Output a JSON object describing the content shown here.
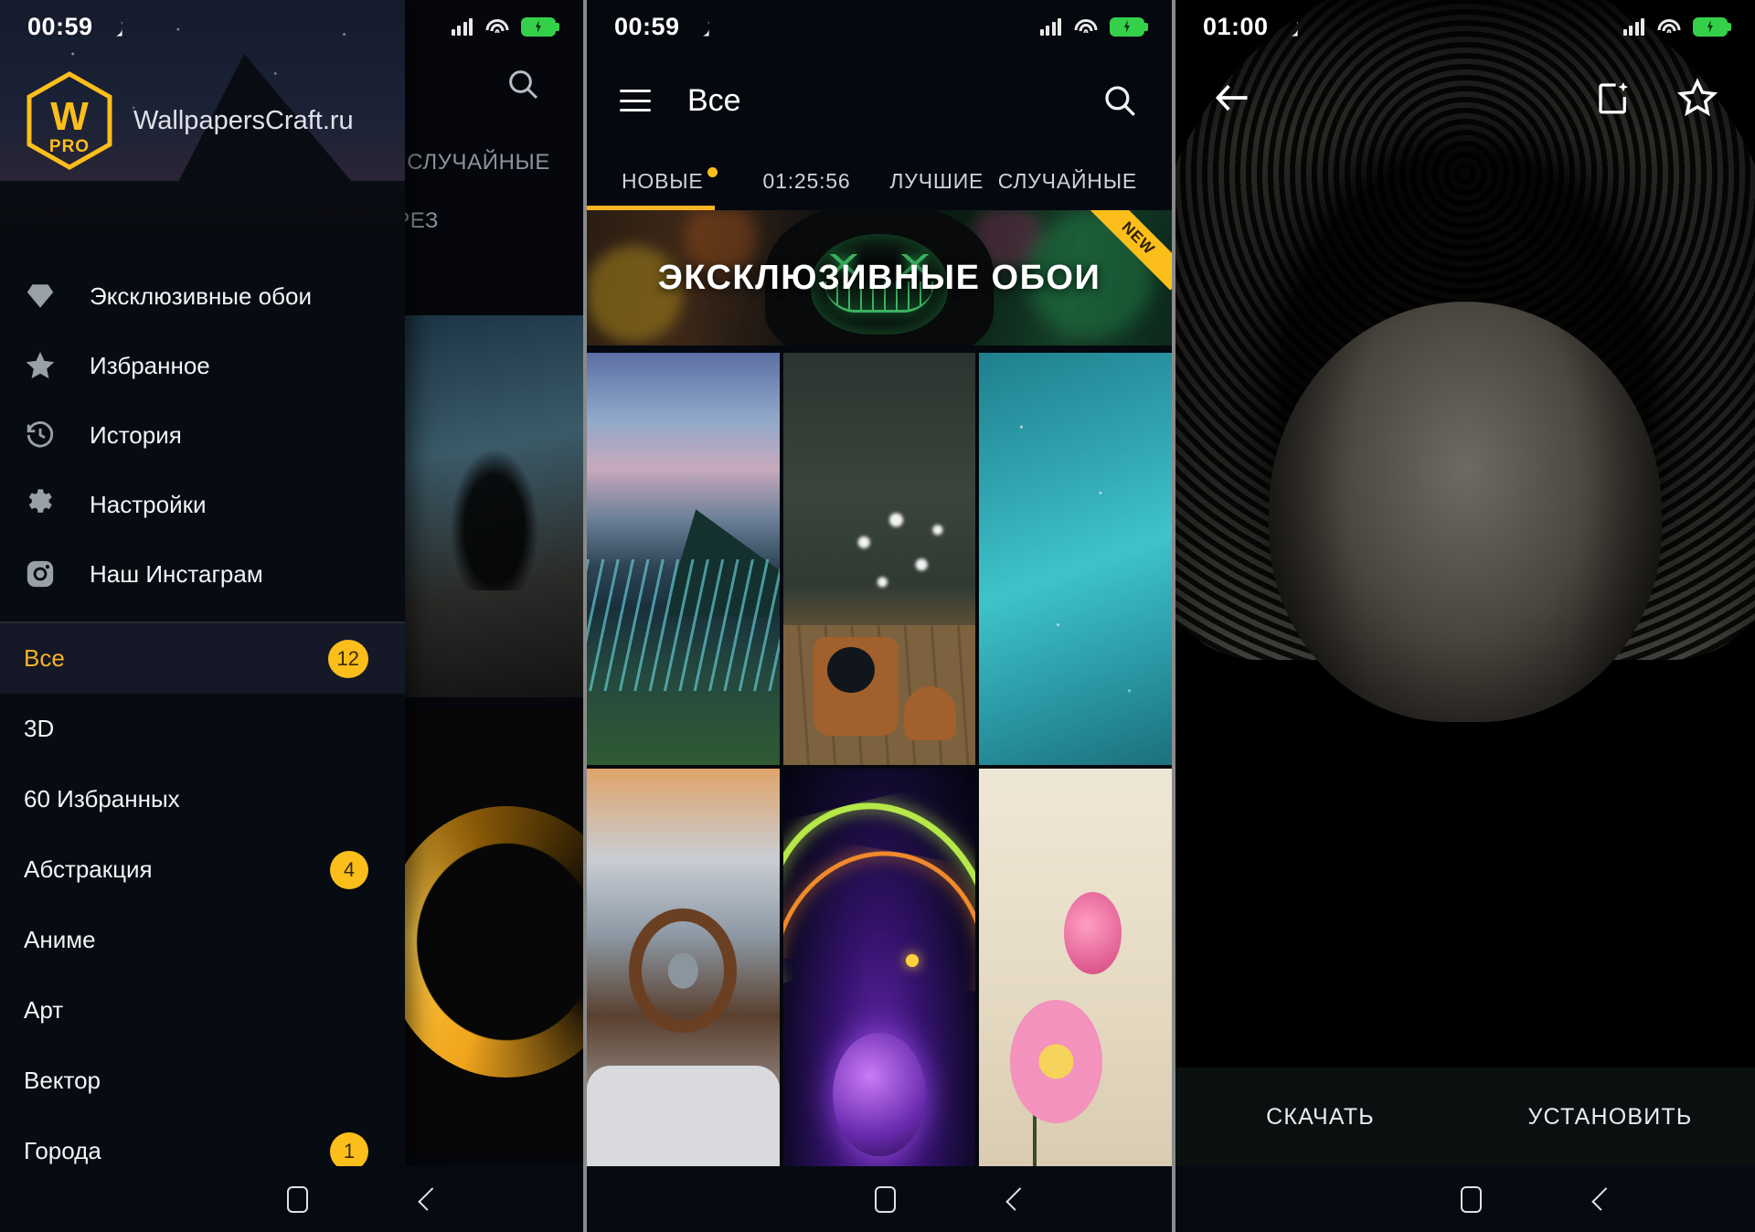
{
  "accent": "#fbbe1b",
  "panel_bg": "#05080f",
  "phone1": {
    "status": {
      "time": "00:59",
      "icons": [
        "moon-icon",
        "signal-icon",
        "wifi-icon",
        "battery-charging-icon"
      ]
    },
    "drawer": {
      "logo_letter": "W",
      "logo_sub": "PRO",
      "site": "WallpapersCraft.ru",
      "items": [
        {
          "label": "Эксклюзивные обои",
          "icon": "diamond-icon"
        },
        {
          "label": "Избранное",
          "icon": "star-icon"
        },
        {
          "label": "История",
          "icon": "history-icon"
        },
        {
          "label": "Настройки",
          "icon": "gear-icon"
        },
        {
          "label": "Наш Инстаграм",
          "icon": "instagram-icon"
        }
      ],
      "categories": [
        {
          "label": "Все",
          "badge": "12",
          "active": true
        },
        {
          "label": "3D",
          "badge": "",
          "active": false
        },
        {
          "label": "60 Избранных",
          "badge": "",
          "active": false
        },
        {
          "label": "Абстракция",
          "badge": "4",
          "active": false
        },
        {
          "label": "Аниме",
          "badge": "",
          "active": false
        },
        {
          "label": "Арт",
          "badge": "",
          "active": false
        },
        {
          "label": "Вектор",
          "badge": "",
          "active": false
        },
        {
          "label": "Города",
          "badge": "1",
          "active": false
        }
      ]
    },
    "behind": {
      "tab_random": "СЛУЧАЙНЫЕ",
      "tab_partial": "ЕРЕЗ",
      "search_icon": "search-icon"
    },
    "navbar": [
      "recents-icon",
      "home-icon",
      "back-icon"
    ]
  },
  "phone2": {
    "status": {
      "time": "00:59"
    },
    "appbar": {
      "menu_icon": "hamburger-icon",
      "title": "Все",
      "search_icon": "search-icon"
    },
    "tabs": [
      {
        "label": "НОВЫЕ",
        "dot": true,
        "active": true
      },
      {
        "label": "01:25:56",
        "dot": false,
        "active": false
      },
      {
        "label": "ЛУЧШИЕ",
        "dot": false,
        "active": false
      },
      {
        "label": "СЛУЧАЙНЫЕ",
        "dot": false,
        "active": false
      }
    ],
    "banner": {
      "text": "ЭКСКЛЮЗИВНЫЕ ОБОИ",
      "ribbon": "NEW"
    },
    "grid": [
      {
        "name": "iceland-river-landscape"
      },
      {
        "name": "teapot-on-pier"
      },
      {
        "name": "teal-gradient"
      },
      {
        "name": "classic-car-interior"
      },
      {
        "name": "neon-space-abstract"
      },
      {
        "name": "pink-flowers"
      }
    ],
    "navbar": [
      "recents-icon",
      "home-icon",
      "back-icon"
    ]
  },
  "phone3": {
    "status": {
      "time": "01:00"
    },
    "appbar": {
      "back_icon": "arrow-left-icon",
      "edit_icon": "magic-edit-icon",
      "favorite_icon": "star-outline-icon"
    },
    "wallpaper": {
      "name": "hooded-cat-heterochromia"
    },
    "buttons": {
      "download": "СКАЧАТЬ",
      "install": "УСТАНОВИТЬ"
    },
    "navbar": [
      "recents-icon",
      "home-icon",
      "back-icon"
    ]
  }
}
